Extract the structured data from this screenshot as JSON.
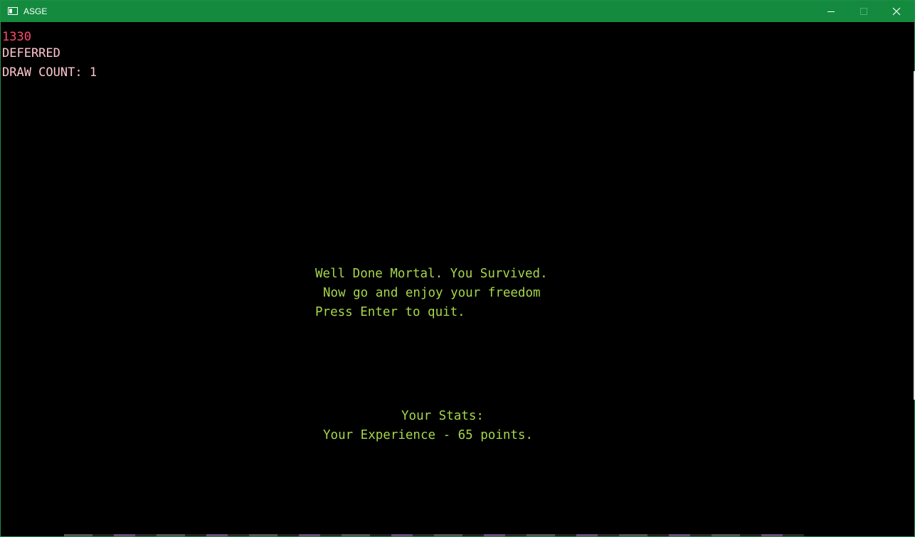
{
  "window": {
    "title": "ASGE",
    "titlebar_color": "#138a3e",
    "controls": {
      "minimize_icon": "minimize-icon",
      "maximize_icon": "maximize-icon",
      "close_icon": "close-icon"
    }
  },
  "debug": {
    "fps": "1330",
    "render_mode": "DEFERRED",
    "draw_count": "DRAW COUNT: 1",
    "fps_color": "#ff4a6e",
    "text_color": "#ffc6d0"
  },
  "game_over": {
    "line1": "Well Done Mortal. You Survived.",
    "line2": "Now go and enjoy your freedom",
    "line3": "Press Enter to quit.",
    "stats_title": "Your Stats:",
    "experience": "Your Experience - 65 points.",
    "text_color": "#a6d64a"
  }
}
